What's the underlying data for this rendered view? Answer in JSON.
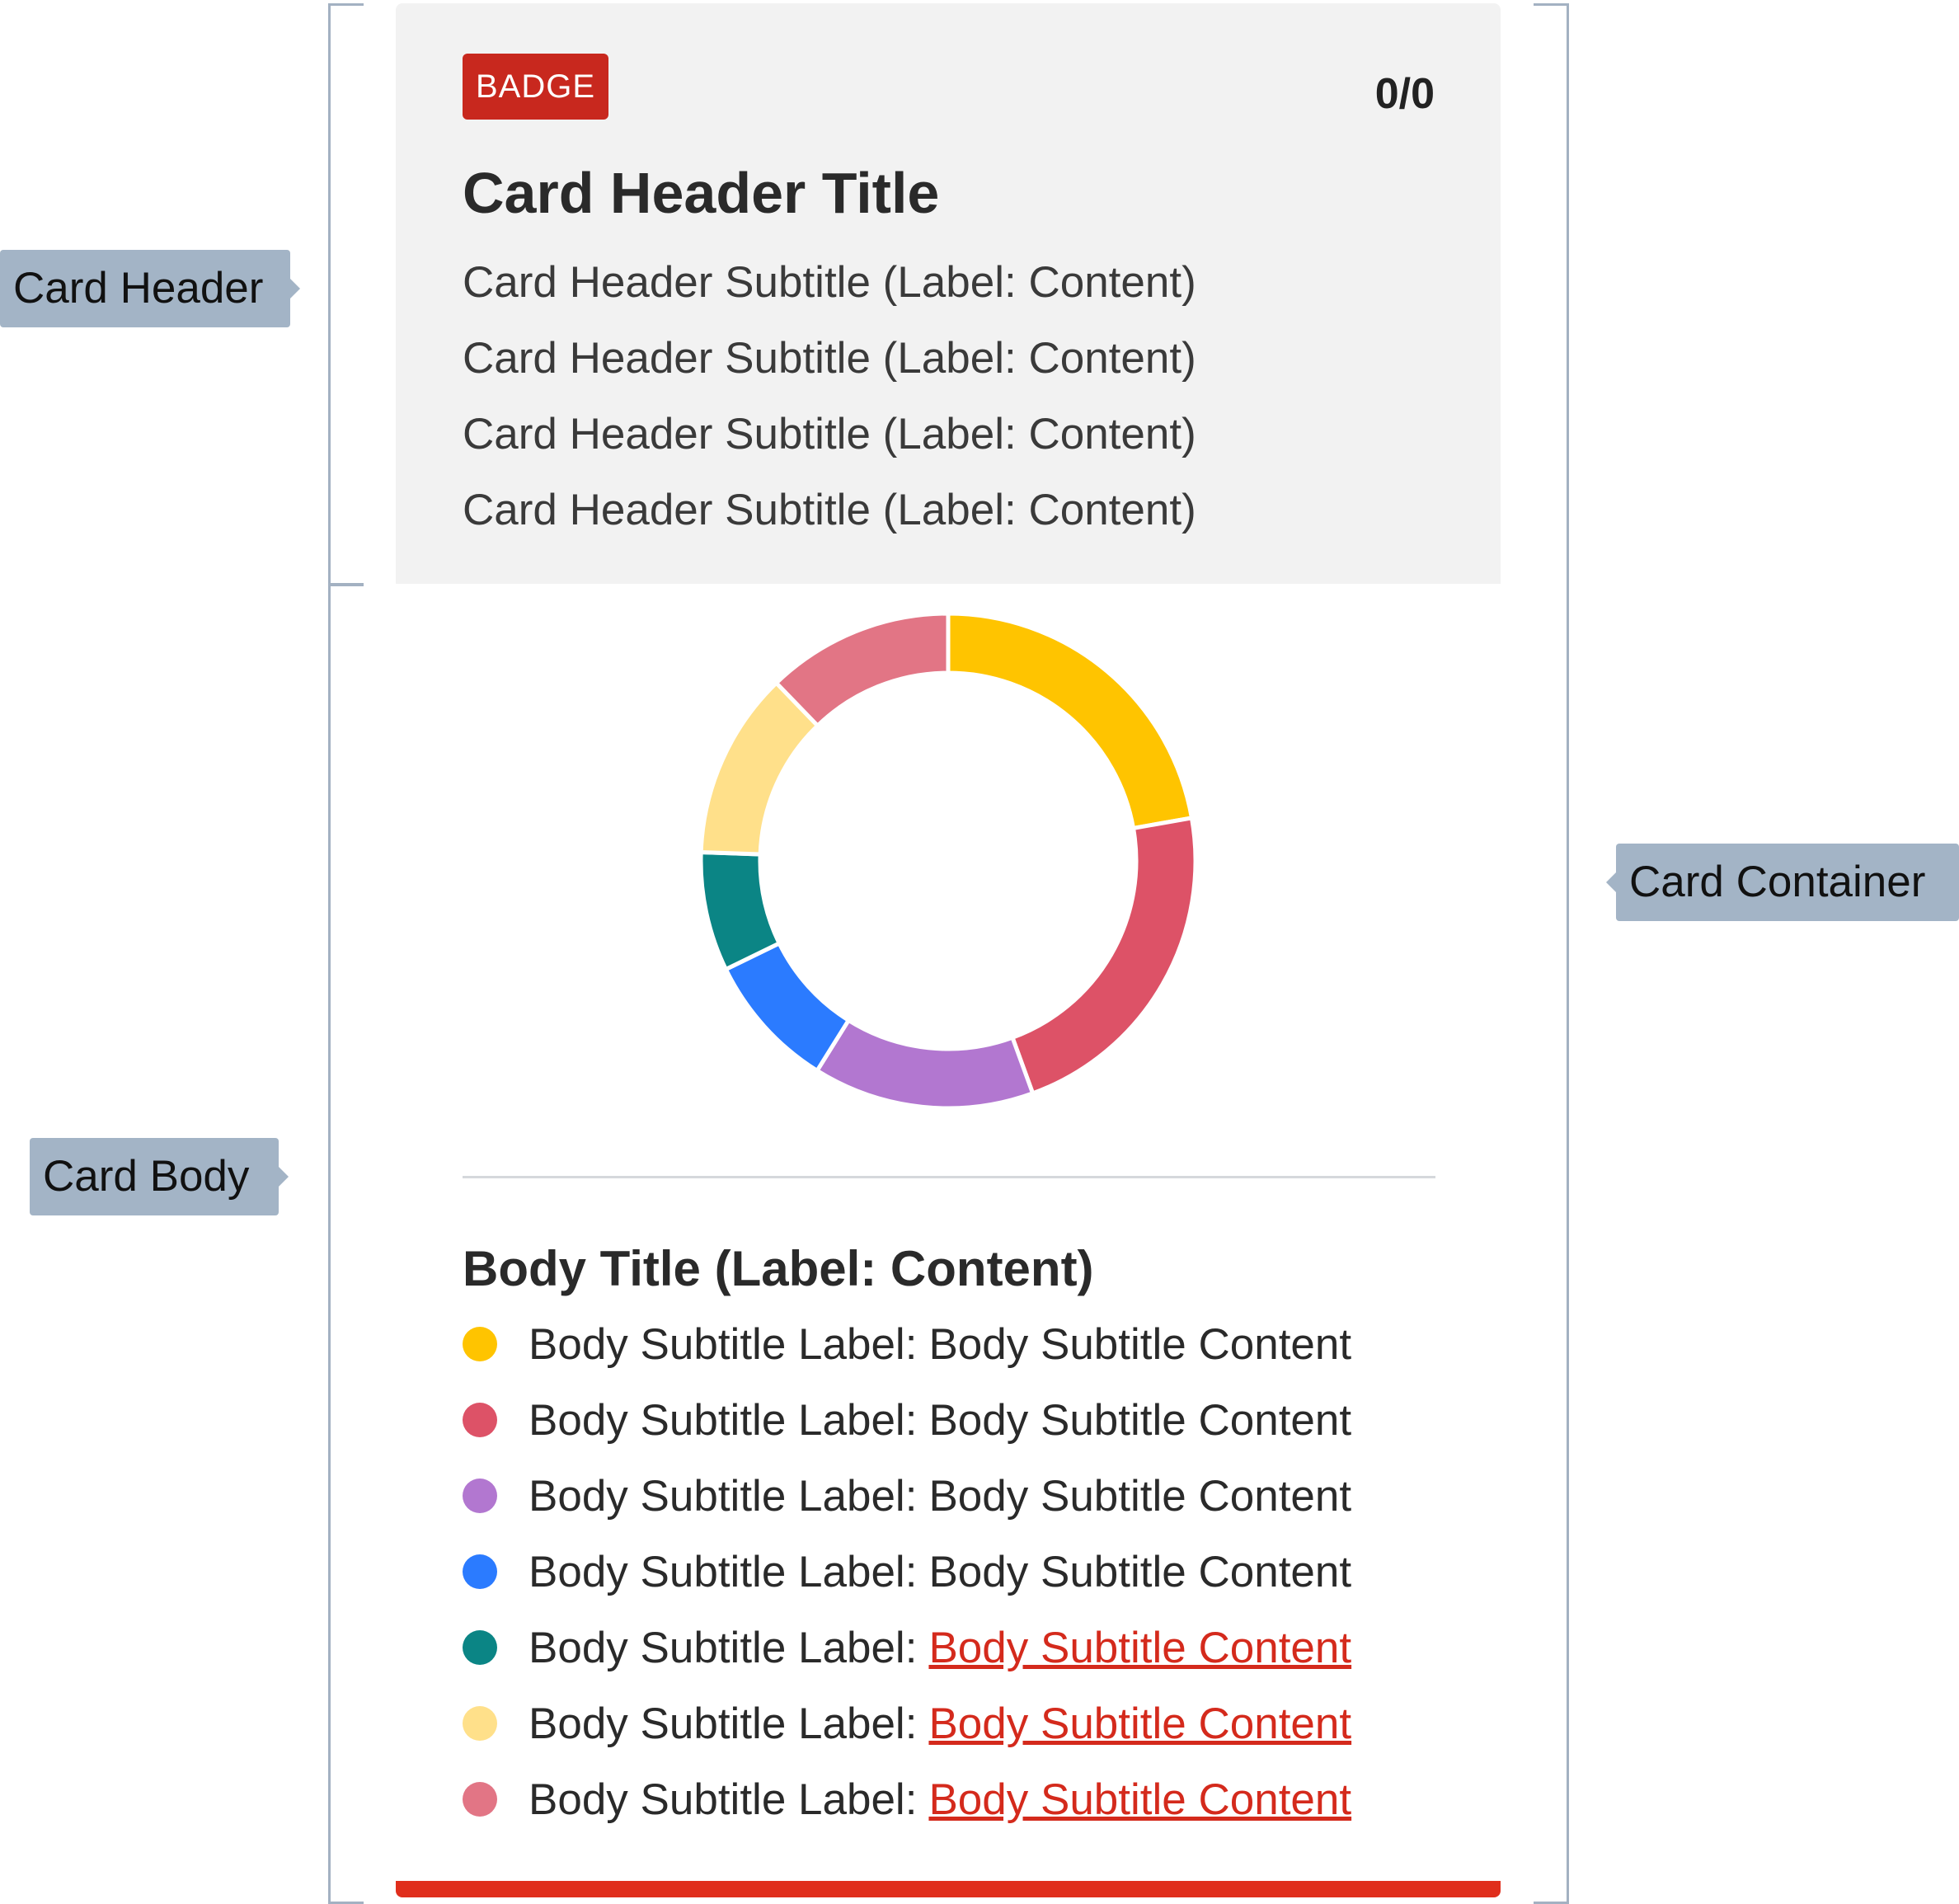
{
  "callouts": {
    "card_header": "Card Header",
    "card_body": "Card Body",
    "card_container": "Card Container"
  },
  "header": {
    "badge": "BADGE",
    "counter": "0/0",
    "title": "Card Header Title",
    "subtitles": [
      "Card Header Subtitle (Label: Content)",
      "Card Header Subtitle (Label: Content)",
      "Card Header Subtitle (Label: Content)",
      "Card Header Subtitle (Label: Content)"
    ]
  },
  "body": {
    "title": "Body Title (Label: Content)",
    "items": [
      {
        "label": "Body Subtitle Label:",
        "content": "Body Subtitle Content",
        "link": false,
        "color": "#ffc400"
      },
      {
        "label": "Body Subtitle Label:",
        "content": "Body Subtitle Content",
        "link": false,
        "color": "#dd5267"
      },
      {
        "label": "Body Subtitle Label:",
        "content": "Body Subtitle Content",
        "link": false,
        "color": "#b277d0"
      },
      {
        "label": "Body Subtitle Label:",
        "content": "Body Subtitle Content",
        "link": false,
        "color": "#2b7bff"
      },
      {
        "label": "Body Subtitle Label:",
        "content": "Body Subtitle Content",
        "link": true,
        "color": "#0b8585"
      },
      {
        "label": "Body Subtitle Label:",
        "content": "Body Subtitle Content",
        "link": true,
        "color": "#ffe08a"
      },
      {
        "label": "Body Subtitle Label:",
        "content": "Body Subtitle Content",
        "link": true,
        "color": "#e27585"
      }
    ]
  },
  "donut": {
    "segments": [
      {
        "value": 20,
        "color": "#ffc400"
      },
      {
        "value": 20,
        "color": "#dd5267"
      },
      {
        "value": 13,
        "color": "#b277d0"
      },
      {
        "value": 8,
        "color": "#2b7bff"
      },
      {
        "value": 7,
        "color": "#0b8585"
      },
      {
        "value": 11,
        "color": "#ffe08a"
      },
      {
        "value": 11,
        "color": "#e27585"
      }
    ]
  },
  "colors": {
    "accent": "#e02e1c",
    "badge": "#c8281e",
    "link": "#d42a1c",
    "header_bg": "#f2f2f2"
  }
}
